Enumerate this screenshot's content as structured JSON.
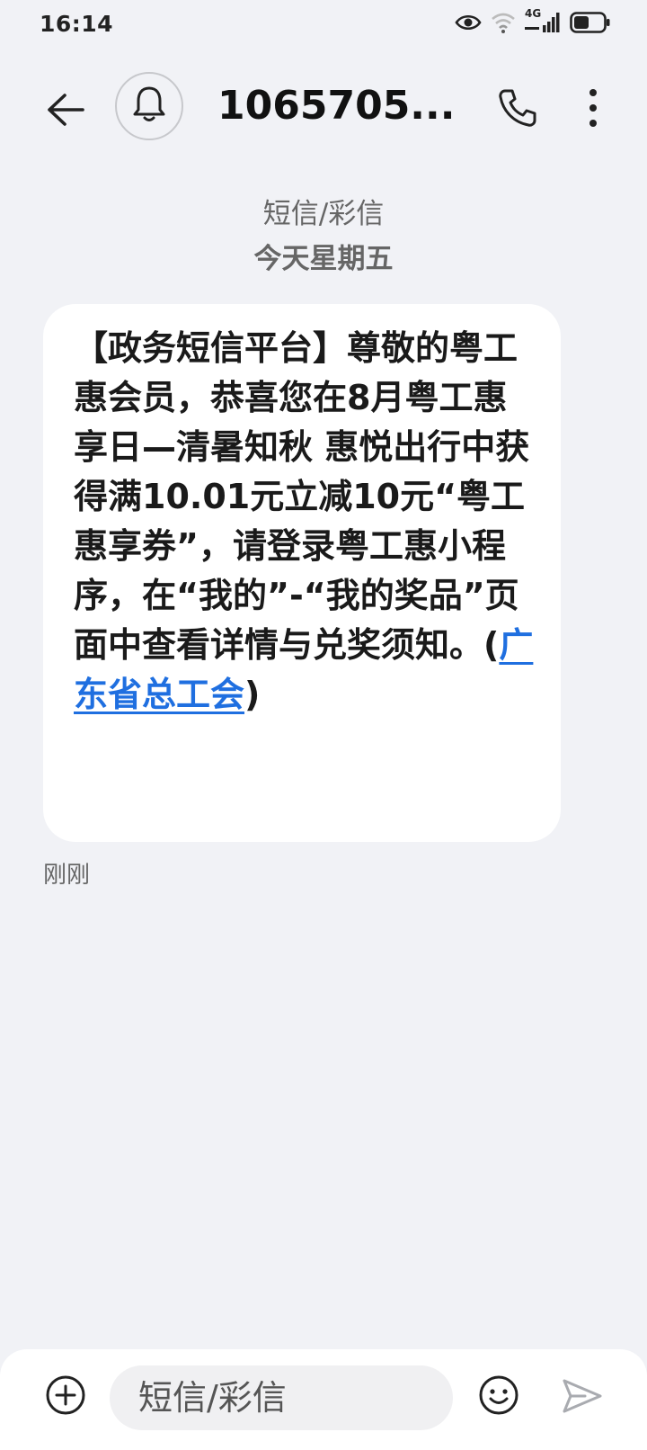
{
  "status_bar": {
    "time": "16:14",
    "network_label": "4G",
    "icons": [
      "eye-icon",
      "wifi-icon",
      "signal-icon",
      "battery-icon"
    ]
  },
  "header": {
    "contact": "1065705...",
    "icons": [
      "back-arrow-icon",
      "bell-icon",
      "phone-icon",
      "more-vertical-icon"
    ]
  },
  "thread": {
    "type_label": "短信/彩信",
    "date_label": "今天星期五"
  },
  "message": {
    "body": "【政务短信平台】尊敬的粤工惠会员，恭喜您在8月粤工惠享日—清暑知秋 惠悦出行中获得满10.01元立减10元“粤工惠享券”，请登录粤工惠小程序，在“我的”-“我的奖品”页面中查看详情与兑奖须知。(",
    "link_text": "广东省总工会",
    "closing": ")",
    "timestamp": "刚刚"
  },
  "composer": {
    "placeholder": "短信/彩信",
    "icons": [
      "add-icon",
      "emoji-icon",
      "send-icon"
    ]
  },
  "colors": {
    "background": "#f1f2f6",
    "bubble": "#ffffff",
    "link": "#1f6fe0"
  }
}
